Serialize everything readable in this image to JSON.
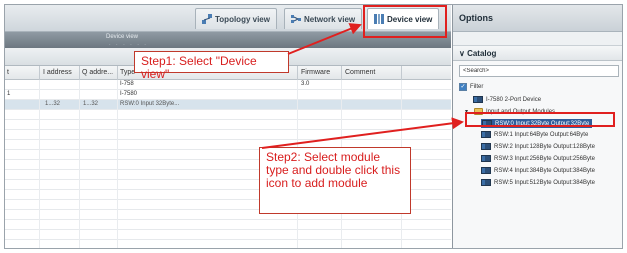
{
  "tabs": {
    "topology": "Topology view",
    "network": "Network view",
    "device": "Device view"
  },
  "subview": {
    "label": "Device view",
    "grip": "· · · · · ·"
  },
  "table": {
    "headers": [
      "t",
      "I address",
      "Q addre...",
      "Type",
      "Firmware",
      "Comment"
    ],
    "rows": [
      {
        "col0": "",
        "iaddr": "",
        "qaddr": "",
        "type": "I-758",
        "fw": "3.0",
        "comment": ""
      },
      {
        "col0": "1",
        "iaddr": "",
        "qaddr": "",
        "type": "I-7580",
        "fw": "",
        "comment": ""
      },
      {
        "col0": "",
        "iaddr": "1...32",
        "qaddr": "1...32",
        "type": "RSW:0 Input 32Byte...",
        "fw": "",
        "comment": ""
      }
    ]
  },
  "annotations": {
    "step1": "Step1: Select \"Device view\"",
    "step2": "Step2: Select module type and double click this icon to add module"
  },
  "options": {
    "title": "Options",
    "catalog_title": "Catalog",
    "search_placeholder": "<Search>",
    "filter_label": "Filter",
    "tree": {
      "device": "I-7580 2-Port Device",
      "folder": "Input and Output Modules",
      "modules": [
        "RSW:0 Input:32Byte Output:32Byte",
        "RSW:1 Input:64Byte Output:64Byte",
        "RSW:2 Input:128Byte Output:128Byte",
        "RSW:3 Input:256Byte Output:256Byte",
        "RSW:4 Input:384Byte Output:384Byte",
        "RSW:5 Input:512Byte Output:384Byte"
      ]
    }
  },
  "colors": {
    "annotation_red": "#e0201f",
    "selection_blue": "#2f5d9a"
  }
}
